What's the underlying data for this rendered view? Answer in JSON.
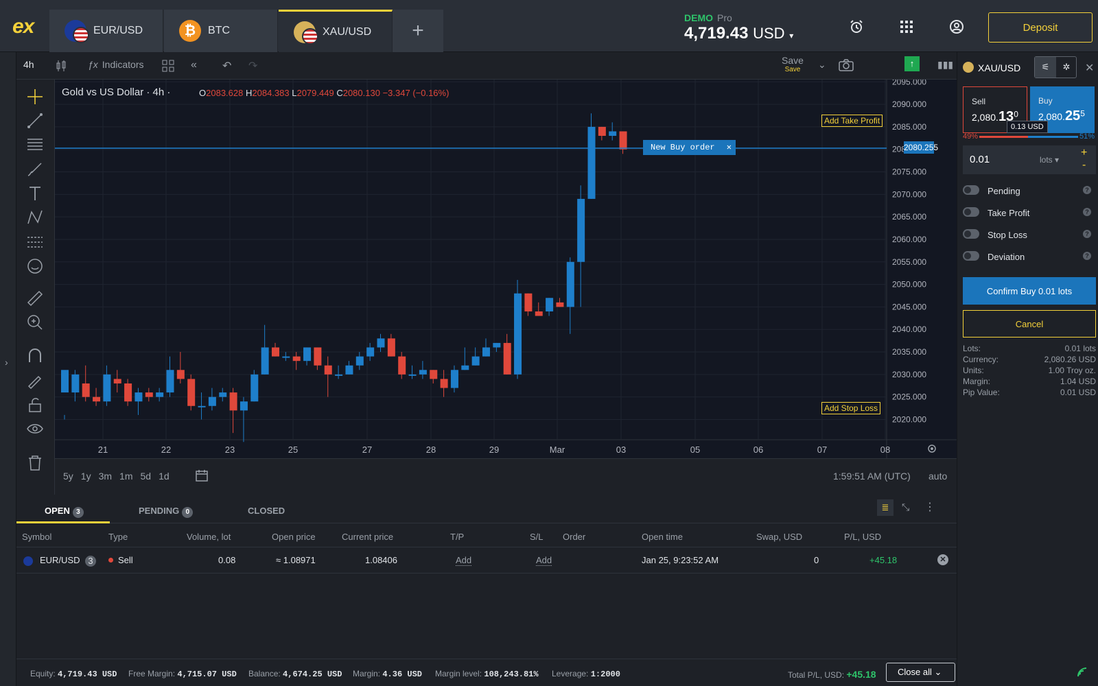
{
  "topbar": {
    "logo": "ex",
    "tabs": [
      {
        "label": "EUR/USD",
        "icon": "eur-usd-flag-icon"
      },
      {
        "label": "BTC",
        "icon": "bitcoin-icon"
      },
      {
        "label": "XAU/USD",
        "icon": "gold-flag-icon",
        "active": true
      }
    ],
    "account_type": "DEMO",
    "account_tier": "Pro",
    "balance": "4,719.43",
    "currency": "USD",
    "deposit_label": "Deposit"
  },
  "toolbar": {
    "interval": "4h",
    "indicators_label": "Indicators",
    "save_label": "Save",
    "save_sub": "Save"
  },
  "chart": {
    "title": "Gold vs US Dollar · 4h ·",
    "ohlc": {
      "o_label": "O",
      "o": "2083.628",
      "h_label": "H",
      "h": "2084.383",
      "l_label": "L",
      "l": "2079.449",
      "c_label": "C",
      "c": "2080.130",
      "change": "−3.347 (−0.16%)"
    },
    "price_line": "2080.255",
    "order_label": "New Buy order",
    "take_profit_label": "Add Take Profit",
    "stop_loss_label": "Add Stop Loss",
    "ranges": [
      "5y",
      "1y",
      "3m",
      "1m",
      "5d",
      "1d"
    ],
    "clock": "1:59:51 AM (UTC)",
    "scale_mode": "auto"
  },
  "chart_data": {
    "type": "candlestick",
    "y_ticks": [
      "2095.000",
      "2090.000",
      "2085.000",
      "2080.000",
      "2075.000",
      "2070.000",
      "2065.000",
      "2060.000",
      "2055.000",
      "2050.000",
      "2045.000",
      "2040.000",
      "2035.000",
      "2030.000",
      "2025.000",
      "2020.000"
    ],
    "x_ticks": [
      "21",
      "22",
      "23",
      "25",
      "27",
      "28",
      "29",
      "Mar",
      "03",
      "05",
      "06",
      "07",
      "08"
    ],
    "ylim": [
      2015.5,
      2095.5
    ],
    "candles": [
      [
        2026,
        2031,
        2021,
        2020
      ],
      [
        2026,
        2030,
        2024,
        2031
      ],
      [
        2028,
        2025,
        2024,
        2032
      ],
      [
        2025,
        2024,
        2023,
        2027
      ],
      [
        2024,
        2030,
        2023,
        2032
      ],
      [
        2029,
        2028,
        2026,
        2031
      ],
      [
        2028,
        2024,
        2023,
        2029
      ],
      [
        2024,
        2026,
        2021,
        2027
      ],
      [
        2026,
        2025,
        2024,
        2027
      ],
      [
        2025,
        2026,
        2024,
        2027
      ],
      [
        2026,
        2031,
        2025,
        2034
      ],
      [
        2031,
        2029,
        2028,
        2035
      ],
      [
        2029,
        2023,
        2022,
        2030
      ],
      [
        2023,
        2023,
        2020,
        2026
      ],
      [
        2023,
        2025,
        2022,
        2027
      ],
      [
        2025,
        2026,
        2024,
        2027
      ],
      [
        2026,
        2022,
        2017,
        2027
      ],
      [
        2022,
        2024,
        2015,
        2025
      ],
      [
        2024,
        2030,
        2024,
        2031
      ],
      [
        2030,
        2036,
        2030,
        2041
      ],
      [
        2036,
        2034,
        2034,
        2037
      ],
      [
        2034,
        2034,
        2033,
        2035
      ],
      [
        2034,
        2033,
        2031,
        2035
      ],
      [
        2033,
        2036,
        2032,
        2036
      ],
      [
        2036,
        2032,
        2031,
        2036
      ],
      [
        2032,
        2030,
        2025,
        2034
      ],
      [
        2030,
        2030,
        2029,
        2032
      ],
      [
        2030,
        2032,
        2030,
        2033
      ],
      [
        2032,
        2034,
        2031,
        2035
      ],
      [
        2034,
        2036,
        2033,
        2037
      ],
      [
        2036,
        2038,
        2035,
        2039
      ],
      [
        2038,
        2034,
        2034,
        2039
      ],
      [
        2034,
        2030,
        2029,
        2035
      ],
      [
        2030,
        2030,
        2029,
        2032
      ],
      [
        2030,
        2031,
        2029,
        2033
      ],
      [
        2031,
        2029,
        2028,
        2031
      ],
      [
        2029,
        2027,
        2025,
        2031
      ],
      [
        2027,
        2031,
        2026,
        2032
      ],
      [
        2031,
        2032,
        2031,
        2036
      ],
      [
        2032,
        2034,
        2032,
        2036
      ],
      [
        2034,
        2036,
        2034,
        2038
      ],
      [
        2036,
        2037,
        2035,
        2037
      ],
      [
        2037,
        2030,
        2030,
        2039
      ],
      [
        2030,
        2048,
        2029,
        2051
      ],
      [
        2048,
        2044,
        2043,
        2048
      ],
      [
        2044,
        2043,
        2043,
        2046
      ],
      [
        2044,
        2047,
        2043,
        2047
      ],
      [
        2046,
        2045,
        2045,
        2047
      ],
      [
        2045,
        2055,
        2039,
        2056
      ],
      [
        2055,
        2069,
        2045,
        2072
      ],
      [
        2069,
        2085,
        2069,
        2088
      ],
      [
        2085,
        2083,
        2082,
        2085
      ],
      [
        2083,
        2084,
        2082,
        2086
      ],
      [
        2084,
        2080,
        2079,
        2084
      ]
    ]
  },
  "trade_panel": {
    "symbol": "XAU/USD",
    "sell_label": "Sell",
    "sell_price_pre": "2,080.",
    "sell_price_big": "13",
    "sell_price_sup": "0",
    "buy_label": "Buy",
    "buy_price_pre": "2,080.",
    "buy_price_big": "25",
    "buy_price_sup": "5",
    "spread": "0.13 USD",
    "sell_pct": "49%",
    "buy_pct": "51%",
    "sell_share": 0.49,
    "volume": "0.01",
    "volume_unit": "lots",
    "toggles": [
      "Pending",
      "Take Profit",
      "Stop Loss",
      "Deviation"
    ],
    "confirm_label": "Confirm Buy 0.01 lots",
    "cancel_label": "Cancel",
    "info": [
      {
        "k": "Lots:",
        "v": "0.01 lots"
      },
      {
        "k": "Currency:",
        "v": "2,080.26 USD"
      },
      {
        "k": "Units:",
        "v": "1.00 Troy oz."
      },
      {
        "k": "Margin:",
        "v": "1.04 USD"
      },
      {
        "k": "Pip Value:",
        "v": "0.01 USD"
      }
    ]
  },
  "orders": {
    "tabs": [
      {
        "label": "OPEN",
        "count": "3"
      },
      {
        "label": "PENDING",
        "count": "0"
      },
      {
        "label": "CLOSED",
        "count": ""
      }
    ],
    "columns": [
      "Symbol",
      "Type",
      "Volume, lot",
      "Open price",
      "Current price",
      "T/P",
      "S/L",
      "Order",
      "Open time",
      "Swap, USD",
      "P/L, USD"
    ],
    "row": {
      "symbol": "EUR/USD",
      "count": "3",
      "type": "Sell",
      "volume": "0.08",
      "open_price": "≈ 1.08971",
      "current_price": "1.08406",
      "tp": "Add",
      "sl": "Add",
      "open_time": "Jan 25, 9:23:52 AM",
      "swap": "0",
      "pl": "+45.18"
    }
  },
  "footer": {
    "equity_label": "Equity:",
    "equity": "4,719.43 USD",
    "free_margin_label": "Free Margin:",
    "free_margin": "4,715.07 USD",
    "balance_label": "Balance:",
    "balance": "4,674.25 USD",
    "margin_label": "Margin:",
    "margin": "4.36 USD",
    "margin_level_label": "Margin level:",
    "margin_level": "108,243.81%",
    "leverage_label": "Leverage:",
    "leverage": "1:2000",
    "total_pl_label": "Total P/L, USD:",
    "total_pl": "+45.18",
    "close_all_label": "Close all"
  },
  "colors": {
    "up": "#1e7fcb",
    "down": "#e0483b",
    "accent": "#f4d13a",
    "profit": "#2ec36a"
  }
}
